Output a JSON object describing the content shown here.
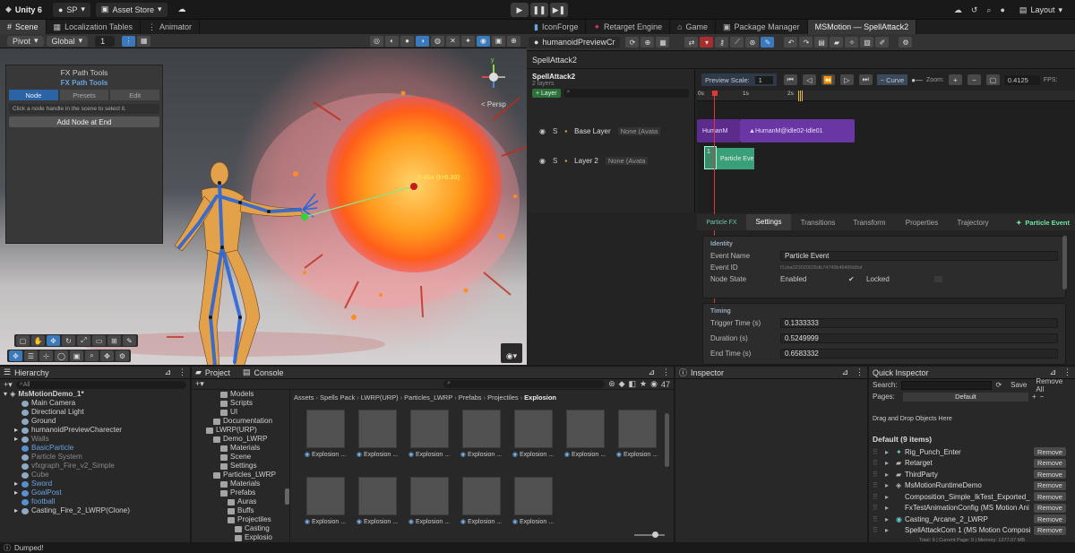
{
  "topbar": {
    "unity": "Unity 6",
    "account": "SP",
    "asset_store": "Asset Store",
    "layout": "Layout"
  },
  "left_tabs": [
    "Scene",
    "Localization Tables",
    "Animator"
  ],
  "scene_toolbar": {
    "pivot": "Pivot",
    "global": "Global",
    "snap": "1",
    "persp": "< Persp"
  },
  "fx_tools": {
    "title": "FX Path Tools",
    "subtitle": "FX Path Tools",
    "tabs": [
      "Node",
      "Presets",
      "Edit"
    ],
    "hint": "Click a node handle in the scene to select it.",
    "add_btn": "Add Node at End"
  },
  "scene_label": {
    "marker": "0.41s  (t=0.33)"
  },
  "right_tabs": [
    "IconForge",
    "Retarget Engine",
    "Game",
    "Package Manager",
    "MSMotion — SpellAttack2"
  ],
  "msm": {
    "dropdown": "humanoidPreviewCr",
    "title": "SpellAttack2",
    "clip": "SpellAttack2",
    "layers_count": "2 layers",
    "add_layer": "+ Layer",
    "preview_scale_label": "Preview Scale:",
    "preview_scale": "1",
    "curve": "Curve",
    "zoom_label": "Zoom:",
    "time": "0.4125",
    "fps": "FPS:",
    "ruler": [
      "0s",
      "1s",
      "2s"
    ],
    "layers": [
      {
        "name": "Base Layer",
        "avatar": "None (Avata"
      },
      {
        "name": "Layer 2",
        "avatar": "None (Avata"
      }
    ],
    "clips": {
      "a": "HumanM",
      "b": "HumanM@idle02-Idle01",
      "c": "1",
      "d": "Particle Eve"
    },
    "insp_tabs": [
      "Particle FX",
      "Settings",
      "Transitions",
      "Transform",
      "Properties",
      "Trajectory"
    ],
    "insp_right": "Particle Event",
    "identity": {
      "header": "Identity",
      "name_k": "Event Name",
      "name_v": "Particle Event",
      "id_k": "Event ID",
      "id_v": "f1cba023020026db74749b48489d9af",
      "state_k": "Node State",
      "enabled": "Enabled",
      "locked": "Locked"
    },
    "timing": {
      "header": "Timing",
      "t_k": "Trigger Time (s)",
      "t_v": "0.1333333",
      "d_k": "Duration (s)",
      "d_v": "0.5249999",
      "e_k": "End Time (s)",
      "e_v": "0.6583332"
    }
  },
  "hierarchy": {
    "tab": "Hierarchy",
    "search": "All",
    "root": "MsMotionDemo_1*",
    "items": [
      {
        "t": "Main Camera",
        "c": "n"
      },
      {
        "t": "Directional Light",
        "c": "n"
      },
      {
        "t": "Ground",
        "c": "n"
      },
      {
        "t": "humanoidPreviewCharecter",
        "c": "n"
      },
      {
        "t": "Walls",
        "c": "g"
      },
      {
        "t": "BasicParticle",
        "c": "b"
      },
      {
        "t": "Particle System",
        "c": "g"
      },
      {
        "t": "vfxgraph_Fire_v2_Simple",
        "c": "g"
      },
      {
        "t": "Cube",
        "c": "g"
      },
      {
        "t": "Sword",
        "c": "b"
      },
      {
        "t": "GoalPost",
        "c": "b"
      },
      {
        "t": "football",
        "c": "b"
      },
      {
        "t": "Casting_Fire_2_LWRP(Clone)",
        "c": "n"
      }
    ]
  },
  "project": {
    "tabs": [
      "Project",
      "Console"
    ],
    "count": "47",
    "tree": [
      "Models",
      "Scripts",
      "UI",
      "Documentation",
      "LWRP(URP)",
      "Demo_LWRP",
      "Materials",
      "Scene",
      "Settings",
      "Particles_LWRP",
      "Materials",
      "Prefabs",
      "Auras",
      "Buffs",
      "Projectiles",
      "Casting",
      "Explosio"
    ],
    "breadcrumb": [
      "Assets",
      "Spells Pack",
      "LWRP(URP)",
      "Particles_LWRP",
      "Prefabs",
      "Projectiles",
      "Explosion"
    ],
    "assets": [
      "Explosion ...",
      "Explosion ...",
      "Explosion ...",
      "Explosion ...",
      "Explosion ...",
      "Explosion ...",
      "Explosion ...",
      "Explosion ...",
      "Explosion ...",
      "Explosion ...",
      "Explosion ...",
      "Explosion ..."
    ]
  },
  "inspector": {
    "tab": "Inspector"
  },
  "quick": {
    "tab": "Quick Inspector",
    "search_label": "Search:",
    "save": "Save",
    "remove_all": "Remove All",
    "pages_label": "Pages:",
    "pages_value": "Default",
    "drag": "Drag and Drop Objects Here",
    "default": "Default (9 items)",
    "remove": "Remove",
    "items": [
      "Rig_Punch_Enter",
      "Retarget",
      "ThirdParty",
      "MsMotionRuntimeDemo",
      "Composition_Simple_IkTest_Exported_fx",
      "FxTestAnimationConfig (MS Motion Ani",
      "Casting_Arcane_2_LWRP",
      "SpellAttackCom 1 (MS Motion Composi"
    ],
    "footer": "Total: 9 | Current Page: 9 | Memory: 1277.07 MB"
  },
  "status": "Dumped!"
}
